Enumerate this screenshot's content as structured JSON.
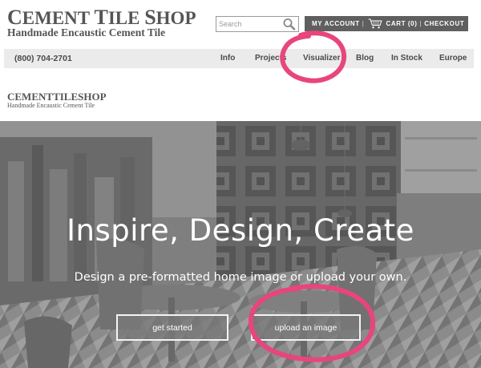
{
  "brand": {
    "name_word1_initial": "C",
    "name_word1_rest": "EMENT",
    "name_word2_initial": "T",
    "name_word2_rest": "ILE",
    "name_word3_initial": "S",
    "name_word3_rest": "HOP",
    "tagline": "Handmade Encaustic Cement Tile"
  },
  "search": {
    "placeholder": "Search",
    "icon": "search-icon"
  },
  "account_bar": {
    "my_account": "MY ACCOUNT",
    "cart_label": "CART (0)",
    "checkout": "CHECKOUT",
    "separator": "|",
    "cart_icon": "cart-icon"
  },
  "navbar": {
    "phone": "(800) 704-2701",
    "items": [
      {
        "label": "Info"
      },
      {
        "label": "Projects"
      },
      {
        "label": "Visualizer"
      },
      {
        "label": "Blog"
      },
      {
        "label": "In Stock"
      },
      {
        "label": "Europe"
      }
    ]
  },
  "hero": {
    "title": "Inspire, Design, Create",
    "subtitle": "Design a pre-formatted home image or upload your own.",
    "buttons": {
      "get_started": "get started",
      "upload": "upload an image"
    }
  },
  "colors": {
    "account_bar_bg": "#5f5f5f",
    "navbar_bg": "#ebebeb",
    "annotation_pink": "#e8457f"
  }
}
